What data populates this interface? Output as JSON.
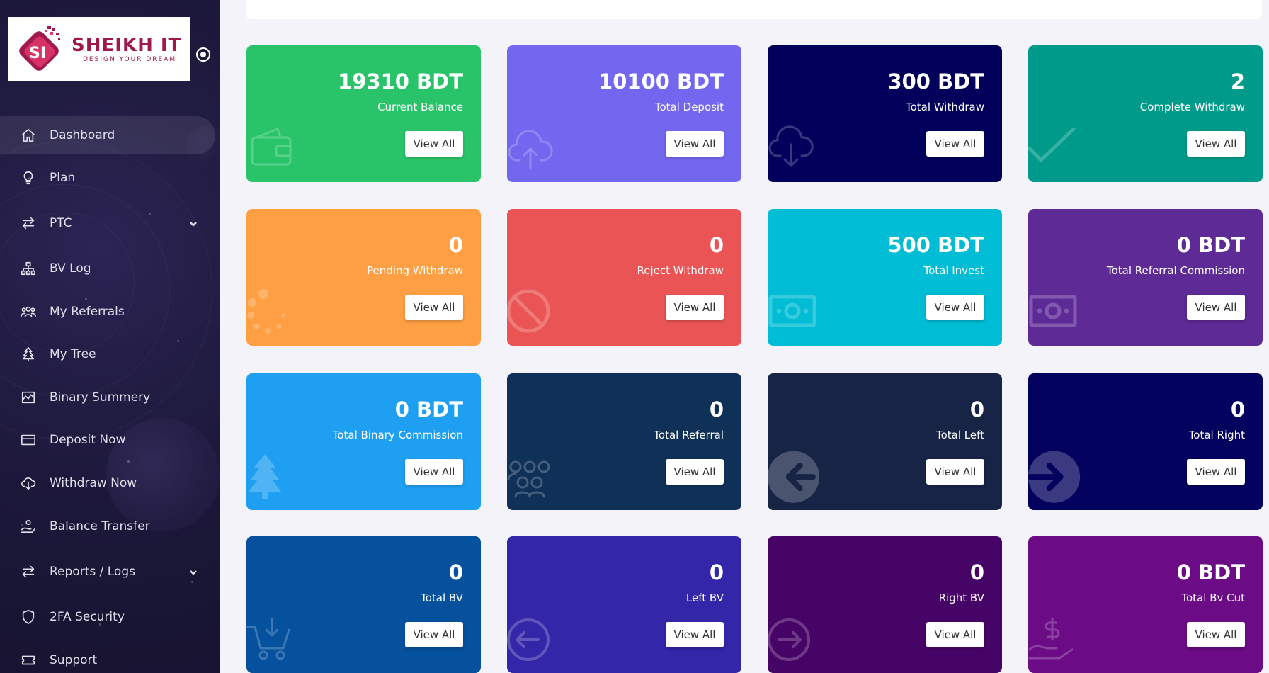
{
  "brand": {
    "title": "SHEIKH IT",
    "tagline": "DESIGN YOUR DREAM",
    "mark_text": "SI",
    "colors": {
      "primary": "#a0184d",
      "accent": "#e53a6b"
    }
  },
  "sidebar": {
    "items": [
      {
        "label": "Dashboard",
        "icon": "home-icon",
        "active": true
      },
      {
        "label": "Plan",
        "icon": "lightbulb-icon"
      },
      {
        "label": "PTC",
        "icon": "arrows-exchange-icon",
        "dropdown": true
      },
      {
        "label": "BV Log",
        "icon": "sitemap-icon"
      },
      {
        "label": "My Referrals",
        "icon": "users-icon"
      },
      {
        "label": "My Tree",
        "icon": "tree-icon"
      },
      {
        "label": "Binary Summery",
        "icon": "chart-area-icon"
      },
      {
        "label": "Deposit Now",
        "icon": "credit-card-icon"
      },
      {
        "label": "Withdraw Now",
        "icon": "cloud-download-icon"
      },
      {
        "label": "Balance Transfer",
        "icon": "hand-coin-icon"
      },
      {
        "label": "Reports / Logs",
        "icon": "arrows-exchange-icon",
        "dropdown": true
      },
      {
        "label": "2FA Security",
        "icon": "shield-icon"
      },
      {
        "label": "Support",
        "icon": "ticket-icon"
      }
    ]
  },
  "cards": [
    {
      "value": "19310 BDT",
      "label": "Current Balance",
      "button": "View All",
      "color": "#29c46a",
      "icon": "wallet-icon"
    },
    {
      "value": "10100 BDT",
      "label": "Total Deposit",
      "button": "View All",
      "color": "#7367f0",
      "icon": "cloud-upload-icon"
    },
    {
      "value": "300 BDT",
      "label": "Total Withdraw",
      "button": "View All",
      "color": "#02005a",
      "icon": "cloud-download-icon"
    },
    {
      "value": "2",
      "label": "Complete Withdraw",
      "button": "View All",
      "color": "#009a8a",
      "icon": "check-icon"
    },
    {
      "value": "0",
      "label": "Pending Withdraw",
      "button": "View All",
      "color": "#ff9f43",
      "icon": "spinner-icon"
    },
    {
      "value": "0",
      "label": "Reject Withdraw",
      "button": "View All",
      "color": "#ea5455",
      "icon": "ban-icon"
    },
    {
      "value": "500 BDT",
      "label": "Total Invest",
      "button": "View All",
      "color": "#00bcd4",
      "icon": "money-bill-icon"
    },
    {
      "value": "0 BDT",
      "label": "Total Referral Commission",
      "button": "View All",
      "color": "#5e2a96",
      "icon": "money-bill-icon"
    },
    {
      "value": "0 BDT",
      "label": "Total Binary Commission",
      "button": "View All",
      "color": "#1e9ff2",
      "icon": "tree-icon"
    },
    {
      "value": "0",
      "label": "Total Referral",
      "button": "View All",
      "color": "#0f3057",
      "icon": "users-icon"
    },
    {
      "value": "0",
      "label": "Total Left",
      "button": "View All",
      "color": "#172446",
      "icon": "arrow-circle-left-icon"
    },
    {
      "value": "0",
      "label": "Total Right",
      "button": "View All",
      "color": "#03025e",
      "icon": "arrow-circle-right-icon"
    },
    {
      "value": "0",
      "label": "Total BV",
      "button": "View All",
      "color": "#05519e",
      "icon": "cart-arrow-down-icon"
    },
    {
      "value": "0",
      "label": "Left BV",
      "button": "View All",
      "color": "#3326a8",
      "icon": "arrow-circle-left-icon"
    },
    {
      "value": "0",
      "label": "Right BV",
      "button": "View All",
      "color": "#470467",
      "icon": "arrow-circle-right-icon"
    },
    {
      "value": "0 BDT",
      "label": "Total Bv Cut",
      "button": "View All",
      "color": "#6b0c86",
      "icon": "hand-dollar-icon"
    }
  ]
}
